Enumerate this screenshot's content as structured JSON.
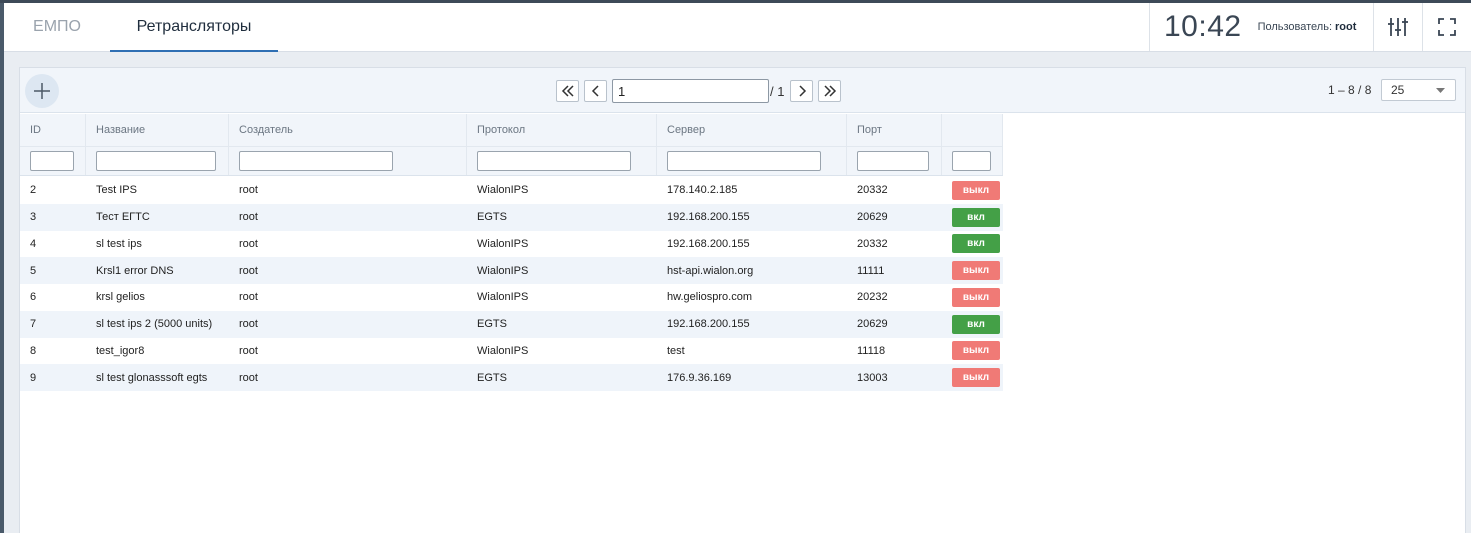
{
  "header": {
    "tabs": [
      {
        "label": "ЕМПО"
      },
      {
        "label": "Ретрансляторы"
      }
    ],
    "clock": "10:42",
    "user_label": "Пользователь:",
    "user_name": "root"
  },
  "toolbar": {
    "page_value": "1",
    "page_total": "/ 1",
    "range": "1 – 8 / 8",
    "per_page": "25"
  },
  "table": {
    "columns": [
      "ID",
      "Название",
      "Создатель",
      "Протокол",
      "Сервер",
      "Порт",
      ""
    ],
    "state_labels": {
      "on": "вкл",
      "off": "выкл"
    },
    "rows": [
      {
        "id": "2",
        "name": "Test IPS",
        "creator": "root",
        "protocol": "WialonIPS",
        "server": "178.140.2.185",
        "port": "20332",
        "state": "выкл",
        "on": false
      },
      {
        "id": "3",
        "name": "Тест ЕГТС",
        "creator": "root",
        "protocol": "EGTS",
        "server": "192.168.200.155",
        "port": "20629",
        "state": "вкл",
        "on": true
      },
      {
        "id": "4",
        "name": "sl test ips",
        "creator": "root",
        "protocol": "WialonIPS",
        "server": "192.168.200.155",
        "port": "20332",
        "state": "вкл",
        "on": true
      },
      {
        "id": "5",
        "name": "Krsl1 error DNS",
        "creator": "root",
        "protocol": "WialonIPS",
        "server": "hst-api.wialon.org",
        "port": "11111",
        "state": "выкл",
        "on": false
      },
      {
        "id": "6",
        "name": "krsl gelios",
        "creator": "root",
        "protocol": "WialonIPS",
        "server": "hw.geliospro.com",
        "port": "20232",
        "state": "выкл",
        "on": false
      },
      {
        "id": "7",
        "name": "sl test ips 2 (5000 units)",
        "creator": "root",
        "protocol": "EGTS",
        "server": "192.168.200.155",
        "port": "20629",
        "state": "вкл",
        "on": true
      },
      {
        "id": "8",
        "name": "test_igor8",
        "creator": "root",
        "protocol": "WialonIPS",
        "server": "test",
        "port": "11118",
        "state": "выкл",
        "on": false
      },
      {
        "id": "9",
        "name": "sl test glonasssoft egts",
        "creator": "root",
        "protocol": "EGTS",
        "server": "176.9.36.169",
        "port": "13003",
        "state": "выкл",
        "on": false
      }
    ]
  },
  "colors": {
    "on": "#44a047",
    "off": "#f07a76",
    "accent": "#2f6fb3"
  },
  "icons": {
    "add": "plus-icon",
    "first": "double-chevron-left-icon",
    "prev": "chevron-left-icon",
    "next": "chevron-right-icon",
    "last": "double-chevron-right-icon",
    "settings": "sliders-icon",
    "fullscreen": "fullscreen-icon",
    "dropdown": "caret-down-icon"
  }
}
